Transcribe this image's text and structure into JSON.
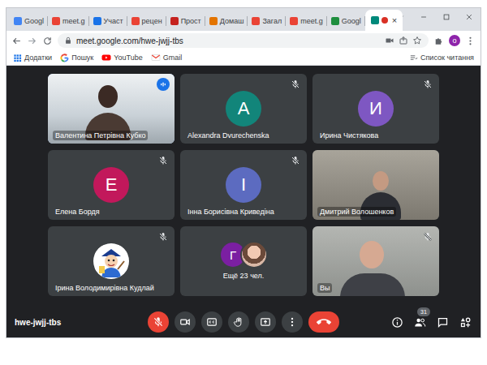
{
  "browser": {
    "tabs": [
      {
        "label": "Googl",
        "selected": false,
        "color": "#4285f4"
      },
      {
        "label": "meet.g",
        "selected": false,
        "color": "#ea4335"
      },
      {
        "label": "Участ",
        "selected": false,
        "color": "#1a73e8"
      },
      {
        "label": "рецен",
        "selected": false,
        "color": "#ea4335"
      },
      {
        "label": "Прост",
        "selected": false,
        "color": "#c5221f"
      },
      {
        "label": "Домаш",
        "selected": false,
        "color": "#e37400"
      },
      {
        "label": "Загал",
        "selected": false,
        "color": "#ea4335"
      },
      {
        "label": "meet.g",
        "selected": false,
        "color": "#ea4335"
      },
      {
        "label": "Googl",
        "selected": false,
        "color": "#1e8e3e"
      },
      {
        "selected": true,
        "color": "#00897b",
        "recording": true,
        "close": "×"
      }
    ],
    "new_tab": "+",
    "address": "meet.google.com/hwe-jwjj-tbs",
    "profile": "o",
    "bookmarks": [
      {
        "label": "Додатки"
      },
      {
        "label": "Пошук"
      },
      {
        "label": "YouTube"
      },
      {
        "label": "Gmail"
      }
    ],
    "reading_list": "Список читання"
  },
  "meeting": {
    "participants": [
      {
        "kind": "video",
        "name": "Валентина Петрівна Кубко",
        "muted": false,
        "speaking": true
      },
      {
        "kind": "avatar",
        "name": "Alexandra Dvurechenska",
        "initial": "A",
        "color": "#12857a",
        "muted": true,
        "speaking": false
      },
      {
        "kind": "avatar",
        "name": "Ирина Чистякова",
        "initial": "И",
        "color": "#7e57c2",
        "muted": true,
        "speaking": false
      },
      {
        "kind": "avatar",
        "name": "Елена Бордя",
        "initial": "Е",
        "color": "#c2185b",
        "muted": true,
        "speaking": false
      },
      {
        "kind": "avatar",
        "name": "Інна Борисівна Криведіна",
        "initial": "І",
        "color": "#5c6bc0",
        "muted": true,
        "speaking": false
      },
      {
        "kind": "video",
        "name": "Дмитрий Волошенков",
        "muted": false,
        "speaking": false
      },
      {
        "kind": "picture",
        "name": "Ірина Володимирівна Кудлай",
        "muted": true,
        "speaking": false
      },
      {
        "kind": "group",
        "initial": "Г",
        "color": "#7b1fa2",
        "label": "Ещё 23 чел."
      },
      {
        "kind": "video",
        "name": "Вы",
        "muted": true,
        "speaking": false
      }
    ],
    "code": "hwe-jwjj-tbs",
    "controls": [
      {
        "kind": "mic",
        "muted": true
      },
      {
        "kind": "camera",
        "muted": false
      },
      {
        "kind": "captions"
      },
      {
        "kind": "hand"
      },
      {
        "kind": "present"
      },
      {
        "kind": "more"
      },
      {
        "kind": "leave"
      }
    ],
    "side_controls": [
      {
        "kind": "info"
      },
      {
        "kind": "people",
        "badge": "31"
      },
      {
        "kind": "chat"
      },
      {
        "kind": "activities"
      }
    ]
  }
}
